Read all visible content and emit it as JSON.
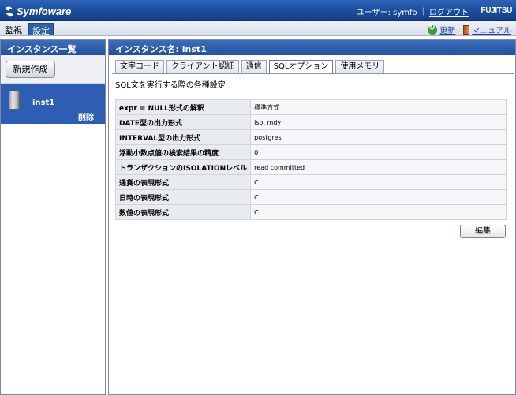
{
  "header": {
    "logo_text": "Symfoware",
    "user_label": "ユーザー: symfo",
    "logout_label": "ログアウト",
    "brand": "FUJITSU"
  },
  "menubar": {
    "tabs": [
      {
        "label": "監視",
        "active": false
      },
      {
        "label": "設定",
        "active": true
      }
    ],
    "refresh_label": "更新",
    "refresh_icon": "refresh-icon",
    "manual_label": "マニュアル",
    "manual_icon": "book-icon"
  },
  "left_panel": {
    "title": "インスタンス一覧",
    "new_button_label": "新規作成",
    "instances": [
      {
        "name": "inst1",
        "delete_label": "削除",
        "icon": "database-icon"
      }
    ]
  },
  "right_panel": {
    "title": "インスタンス名: inst1",
    "tabs": [
      {
        "label": "文字コード",
        "active": false
      },
      {
        "label": "クライアント認証",
        "active": false
      },
      {
        "label": "通信",
        "active": false
      },
      {
        "label": "SQLオプション",
        "active": true
      },
      {
        "label": "使用メモリ",
        "active": false
      }
    ],
    "description": "SQL文を実行する際の各種設定",
    "settings": [
      {
        "key": "expr = NULL形式の解釈",
        "value": "標準方式"
      },
      {
        "key": "DATE型の出力形式",
        "value": "iso, mdy"
      },
      {
        "key": "INTERVAL型の出力形式",
        "value": "postgres"
      },
      {
        "key": "浮動小数点値の検索結果の精度",
        "value": "0"
      },
      {
        "key": "トランザクションのISOLATIONレベル",
        "value": "read committed"
      },
      {
        "key": "通貨の表現形式",
        "value": "C"
      },
      {
        "key": "日時の表現形式",
        "value": "C"
      },
      {
        "key": "数値の表現形式",
        "value": "C"
      }
    ],
    "edit_button_label": "編集"
  },
  "colors": {
    "header_blue": "#1a4c9c",
    "selected_blue": "#2d5eb4",
    "link_blue": "#1a3f9e"
  }
}
